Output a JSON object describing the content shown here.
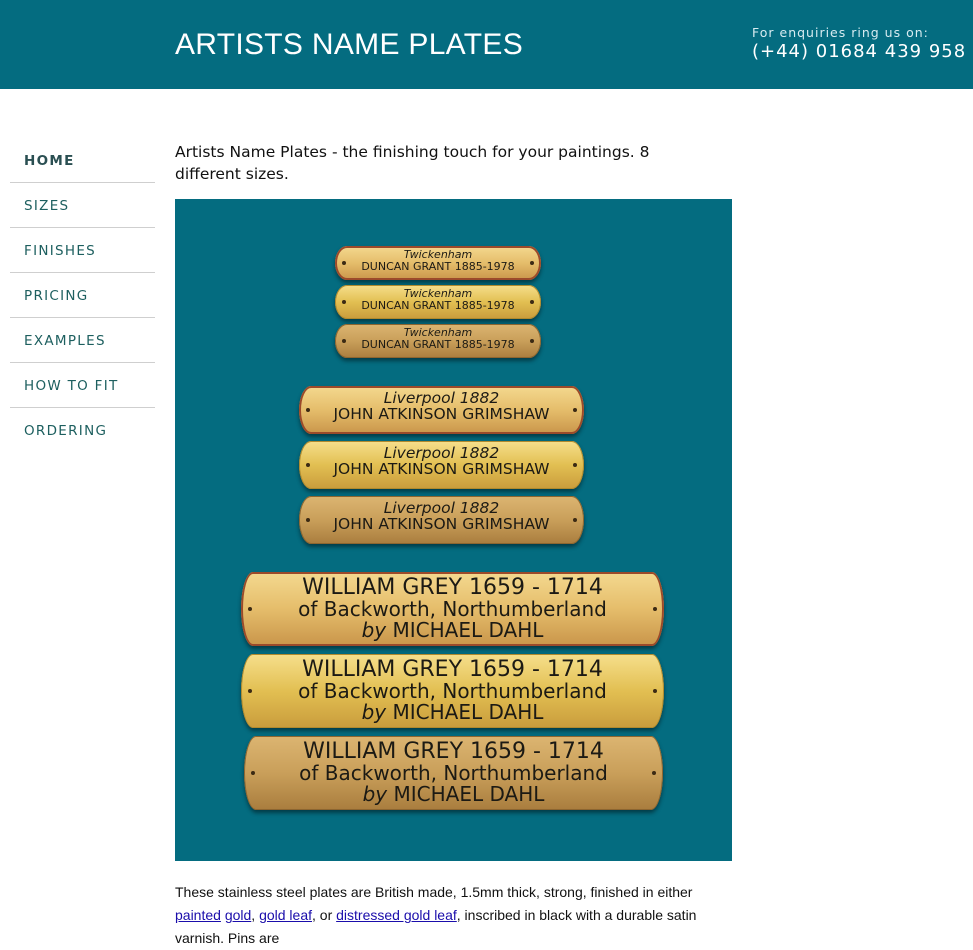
{
  "header": {
    "title": "ARTISTS NAME PLATES",
    "enquiry_label": "For enquiries ring us on:",
    "phone": "(+44) 01684 439 958"
  },
  "nav": {
    "items": [
      {
        "label": "HOME",
        "active": true
      },
      {
        "label": "SIZES"
      },
      {
        "label": "FINISHES"
      },
      {
        "label": "PRICING"
      },
      {
        "label": "EXAMPLES"
      },
      {
        "label": "HOW TO FIT"
      },
      {
        "label": "ORDERING"
      }
    ]
  },
  "main": {
    "intro": "Artists Name Plates - the finishing touch for your paintings. 8 different sizes.",
    "hero": {
      "small_plates": {
        "line1": "Twickenham",
        "line2": "DUNCAN GRANT 1885-1978"
      },
      "medium_plates": {
        "line1": "Liverpool 1882",
        "line2": "JOHN ATKINSON GRIMSHAW"
      },
      "large_plates": {
        "line1": "WILLIAM GREY 1659 - 1714",
        "line2": "of Backworth, Northumberland",
        "line3_by": "by",
        "line3_name": "MICHAEL DAHL"
      }
    },
    "body": {
      "text_1": "These stainless steel plates are British made, 1.5mm thick, strong, finished in either ",
      "link_painted": "painted",
      "link_gold": "gold",
      "sep_1": ", ",
      "link_gold_leaf": "gold leaf",
      "text_2": ", or ",
      "link_distressed": "distressed gold leaf",
      "text_3": ", inscribed in black with a durable satin varnish. Pins are"
    }
  },
  "colors": {
    "header_bg": "#046c80",
    "nav_text": "#1d5f5f",
    "link": "#1a0dab"
  }
}
